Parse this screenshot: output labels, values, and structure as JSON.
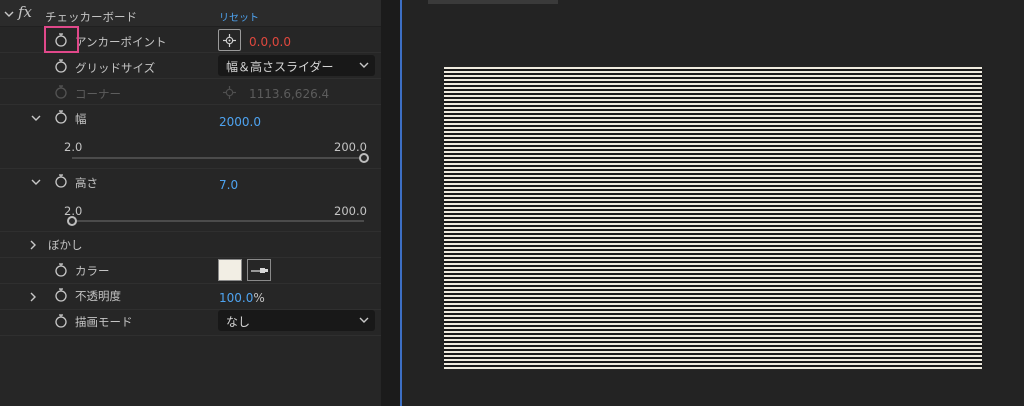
{
  "effect": {
    "fx_label": "fx",
    "name": "チェッカーボード",
    "reset_label": "リセット"
  },
  "properties": {
    "anchor": {
      "label": "アンカーポイント",
      "value": "0.0,0.0"
    },
    "grid_size": {
      "label": "グリッドサイズ",
      "value": "幅＆高さスライダー"
    },
    "corner": {
      "label": "コーナー",
      "value": "1113.6,626.4"
    },
    "width": {
      "label": "幅",
      "value": "2000.0",
      "slider": {
        "min": "2.0",
        "max": "200.0",
        "position": 1.0
      }
    },
    "height": {
      "label": "高さ",
      "value": "7.0",
      "slider": {
        "min": "2.0",
        "max": "200.0",
        "position": 0.0
      }
    },
    "blur": {
      "label": "ぼかし"
    },
    "color": {
      "label": "カラー",
      "swatch": "#f2eee4"
    },
    "opacity": {
      "label": "不透明度",
      "value": "100.0",
      "unit": "%"
    },
    "blend_mode": {
      "label": "描画モード",
      "value": "なし"
    }
  },
  "colors": {
    "value_blue": "#4ea3f0",
    "value_red": "#e0483e",
    "highlight": "#e0488a",
    "checker_light": "#efebdf",
    "checker_dark": "#191919"
  }
}
